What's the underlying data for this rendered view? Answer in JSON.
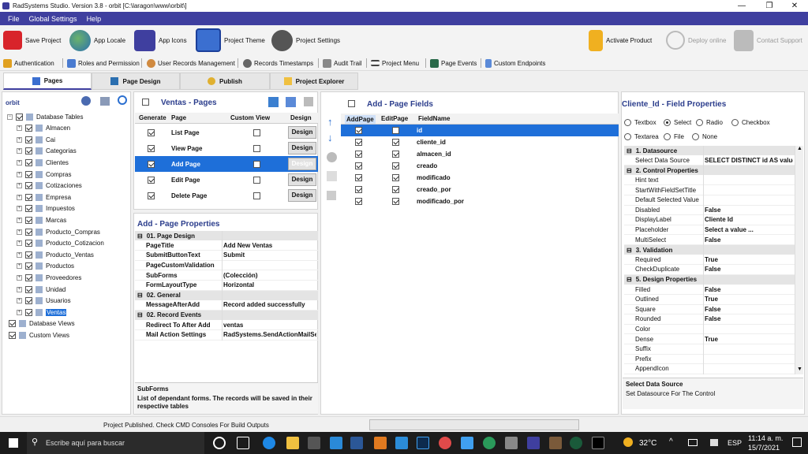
{
  "window": {
    "title": "RadSystems Studio.  Version 3.8 - orbit [C:\\laragon\\www\\orbit\\]"
  },
  "menu": [
    "File",
    "Global Settings",
    "Help"
  ],
  "toolbar": {
    "save": "Save Project",
    "locale": "App Locale",
    "icons": "App Icons",
    "theme": "Project Theme",
    "settings": "Project Settings",
    "activate": "Activate Product",
    "deploy": "Deploy online",
    "support": "Contact Support"
  },
  "toolbar2": {
    "auth": "Authentication",
    "roles": "Roles and Permission",
    "users": "User Records Management",
    "timestamps": "Records Timestamps",
    "audit": "Audit Trail",
    "menu": "Project Menu",
    "events": "Page Events",
    "endpoints": "Custom Endpoints"
  },
  "tabs": [
    "Pages",
    "Page Design",
    "Publish",
    "Project Explorer"
  ],
  "tree": {
    "root": "orbit",
    "db_tables": "Database Tables",
    "items": [
      "Almacen",
      "Cai",
      "Categorias",
      "Clientes",
      "Compras",
      "Cotizaciones",
      "Empresa",
      "Impuestos",
      "Marcas",
      "Producto_Compras",
      "Producto_Cotizacion",
      "Producto_Ventas",
      "Productos",
      "Proveedores",
      "Unidad",
      "Usuarios",
      "Ventas"
    ],
    "db_views": "Database Views",
    "custom_views": "Custom Views"
  },
  "pages": {
    "title": "Ventas - Pages",
    "headers": [
      "Generate",
      "Page",
      "Custom View",
      "Design"
    ],
    "rows": [
      {
        "page": "List Page",
        "gen": true,
        "custom": false
      },
      {
        "page": "View Page",
        "gen": true,
        "custom": false
      },
      {
        "page": "Add Page",
        "gen": true,
        "custom": false
      },
      {
        "page": "Edit Page",
        "gen": true,
        "custom": false
      },
      {
        "page": "Delete Page",
        "gen": true,
        "custom": false
      }
    ],
    "design_label": "Design"
  },
  "page_props": {
    "title": "Add - Page Properties",
    "sections": [
      {
        "name": "01. Page Design",
        "rows": [
          [
            "PageTitle",
            "Add New Ventas"
          ],
          [
            "SubmitButtonText",
            "Submit"
          ],
          [
            "PageCustomValidation",
            ""
          ],
          [
            "SubForms",
            "(Colección)"
          ],
          [
            "FormLayoutType",
            "Horizontal"
          ]
        ]
      },
      {
        "name": "02. General",
        "rows": [
          [
            "MessageAfterAdd",
            "Record added successfully"
          ]
        ]
      },
      {
        "name": "02. Record Events",
        "rows": [
          [
            "Redirect To After Add",
            "ventas"
          ],
          [
            "Mail Action Settings",
            "RadSystems.SendActionMailSett"
          ]
        ]
      }
    ],
    "help_title": "SubForms",
    "help_text": "List of dependant forms. The records will be saved in their respective tables"
  },
  "fields": {
    "title": "Add - Page Fields",
    "headers": [
      "AddPage",
      "EditPage",
      "FieldName"
    ],
    "rows": [
      {
        "name": "id",
        "add": true,
        "edit": false
      },
      {
        "name": "cliente_id",
        "add": true,
        "edit": true
      },
      {
        "name": "almacen_id",
        "add": true,
        "edit": true
      },
      {
        "name": "creado",
        "add": true,
        "edit": true
      },
      {
        "name": "modificado",
        "add": true,
        "edit": true
      },
      {
        "name": "creado_por",
        "add": true,
        "edit": true
      },
      {
        "name": "modificado_por",
        "add": true,
        "edit": true
      }
    ]
  },
  "field_props": {
    "title": "Cliente_Id - Field Properties",
    "types": [
      "Textbox",
      "Select",
      "Radio",
      "Checkbox",
      "Textarea",
      "File",
      "None"
    ],
    "selected_type": "Select",
    "sections": [
      {
        "name": "1. Datasource",
        "rows": [
          [
            "Select Data Source",
            "SELECT  DISTINCT id AS value"
          ]
        ]
      },
      {
        "name": "2. Control Properties",
        "rows": [
          [
            "Hint text",
            ""
          ],
          [
            "StartWithFieldSetTitle",
            ""
          ],
          [
            "Default Selected Value",
            ""
          ],
          [
            "Disabled",
            "False"
          ],
          [
            "DisplayLabel",
            "Cliente Id"
          ],
          [
            "Placeholder",
            "Select a value ..."
          ],
          [
            "MultiSelect",
            "False"
          ]
        ]
      },
      {
        "name": "3. Validation",
        "rows": [
          [
            "Required",
            "True"
          ],
          [
            "CheckDuplicate",
            "False"
          ]
        ]
      },
      {
        "name": "5. Design Properties",
        "rows": [
          [
            "Filled",
            "False"
          ],
          [
            "Outlined",
            "True"
          ],
          [
            "Square",
            "False"
          ],
          [
            "Rounded",
            "False"
          ],
          [
            "Color",
            ""
          ],
          [
            "Dense",
            "True"
          ],
          [
            "Suffix",
            ""
          ],
          [
            "Prefix",
            ""
          ],
          [
            "AppendIcon",
            ""
          ]
        ]
      }
    ],
    "help_title": "Select Data Source",
    "help_text": "Set Datasource For The Control"
  },
  "status": "Project Published. Check CMD Consoles For Build Outputs",
  "taskbar": {
    "search": "Escribe aquí para buscar",
    "temp": "32°C",
    "lang": "ESP",
    "time": "11:14 a. m.",
    "date": "15/7/2021"
  }
}
